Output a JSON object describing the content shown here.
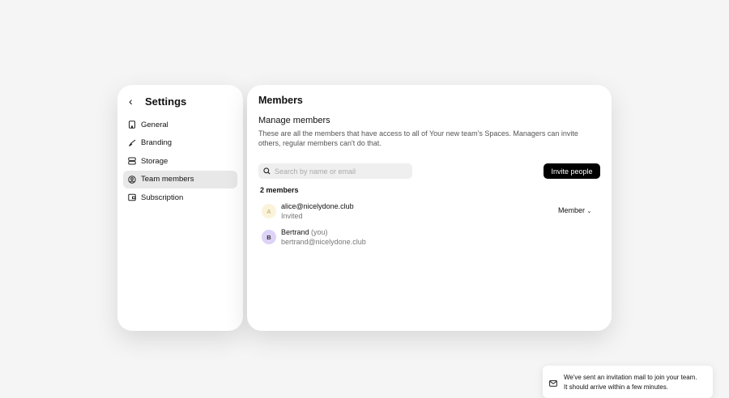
{
  "sidebar": {
    "title": "Settings",
    "items": [
      {
        "label": "General",
        "icon": "building-icon"
      },
      {
        "label": "Branding",
        "icon": "paintbrush-icon"
      },
      {
        "label": "Storage",
        "icon": "database-icon"
      },
      {
        "label": "Team members",
        "icon": "user-circle-icon",
        "active": true
      },
      {
        "label": "Subscription",
        "icon": "wallet-icon"
      }
    ]
  },
  "main": {
    "title": "Members",
    "section_title": "Manage members",
    "description": "These are all the members that have access to all of Your new team's Spaces. Managers can invite others, regular members can't do that.",
    "search_placeholder": "Search by name or email",
    "invite_label": "Invite people",
    "count": "2 members",
    "members": [
      {
        "initial": "A",
        "name": "alice@nicelydone.club",
        "sub": "Invited",
        "role": "Member",
        "avatar_bg": "#fbf3d9",
        "avatar_fg": "#c9b98a"
      },
      {
        "initial": "B",
        "name": "Bertrand",
        "you": "(you)",
        "sub": "bertrand@nicelydone.club",
        "avatar_bg": "#ddd3f7",
        "avatar_fg": "#333"
      }
    ]
  },
  "toast": {
    "line1": "We've sent an invitation mail to join your team.",
    "line2": "It should arrive within a few minutes."
  }
}
